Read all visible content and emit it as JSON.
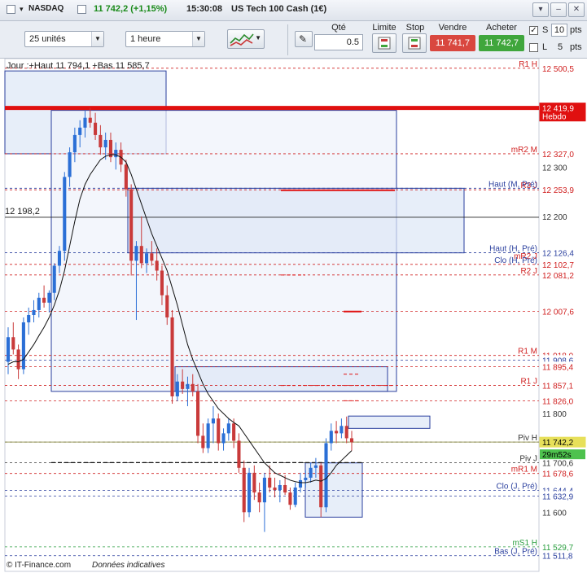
{
  "header": {
    "symbol": "NASDAQ",
    "price": "11 742,2 (+1,15%)",
    "time": "15:30:08",
    "instrument": "US Tech 100 Cash (1€)"
  },
  "window_buttons": [
    "▾",
    "–",
    "✕"
  ],
  "toolbar": {
    "units_select": "25 unités",
    "period_select": "1 heure",
    "qty_label": "Qté",
    "qty_value": "0.5",
    "limit_label": "Limite",
    "stop_label": "Stop",
    "sell_label": "Vendre",
    "sell_price": "11 741,7",
    "buy_label": "Acheter",
    "buy_price": "11 742,7",
    "s_value": "10",
    "s_label": "S",
    "l_value": "5",
    "l_label": "L",
    "pts_label": "pts",
    "colors": {
      "sell": "#d9473f",
      "buy": "#3fa63c"
    }
  },
  "chart": {
    "info_text": "Jour :+Haut 11 794,1 +Bas 11 585,7",
    "crosshair_label": "12 198,2",
    "footer_brand": "© IT-Finance.com",
    "footer_note": "Données indicatives",
    "countdown": "29m52s",
    "price_axis": [
      "12 400",
      "12 300",
      "12 200",
      "11 800",
      "11 600"
    ],
    "right_tags": [
      {
        "text": "12 500,5",
        "value": 12500.5,
        "color": "#d02020"
      },
      {
        "text": "12 419,9",
        "value": 12419.9,
        "color": "#d02020",
        "sub": "Hebdo",
        "fill": true
      },
      {
        "text": "12 327,0",
        "value": 12327.0,
        "color": "#d02020"
      },
      {
        "text": "12 257,0",
        "value": 12257.0,
        "color": "#2a3f9e"
      },
      {
        "text": "12 253,9",
        "value": 12253.9,
        "color": "#d02020"
      },
      {
        "text": "12 126,4",
        "value": 12126.4,
        "color": "#2a3f9e"
      },
      {
        "text": "12 102,7",
        "value": 12102.7,
        "color": "#d02020"
      },
      {
        "text": "12 081,2",
        "value": 12081.2,
        "color": "#d02020"
      },
      {
        "text": "12 007,6",
        "value": 12007.6,
        "color": "#d02020"
      },
      {
        "text": "11 918,0",
        "value": 11918.0,
        "color": "#d02020"
      },
      {
        "text": "11 908,6",
        "value": 11908.6,
        "color": "#2a3f9e"
      },
      {
        "text": "11 895,4",
        "value": 11895.4,
        "color": "#d02020"
      },
      {
        "text": "11 857,1",
        "value": 11857.1,
        "color": "#d02020"
      },
      {
        "text": "11 826,0",
        "value": 11826.0,
        "color": "#d02020"
      },
      {
        "text": "11 742,2",
        "value": 11742.2,
        "color": "#333",
        "fill": "#e7e05a"
      },
      {
        "text": "11 700,6",
        "value": 11700.6,
        "color": "#333"
      },
      {
        "text": "11 678,6",
        "value": 11678.6,
        "color": "#d02020"
      },
      {
        "text": "11 644,4",
        "value": 11644.4,
        "color": "#2a3f9e"
      },
      {
        "text": "11 632,9",
        "value": 11632.9,
        "color": "#2a3f9e"
      },
      {
        "text": "11 529,7",
        "value": 11529.7,
        "color": "#2a9e3f"
      },
      {
        "text": "11 511,8",
        "value": 11511.8,
        "color": "#2a3f9e"
      }
    ],
    "level_labels": [
      {
        "text": "R1 H",
        "value": 12500.5,
        "color": "#d02020"
      },
      {
        "text": "mR2 M",
        "value": 12327.0,
        "color": "#d02020"
      },
      {
        "text": "R3 J",
        "value": 12253.9,
        "color": "#d02020"
      },
      {
        "text": "Haut (M, Pré)",
        "value": 12257.0,
        "color": "#2a3f9e"
      },
      {
        "text": "Haut (H, Pré)",
        "value": 12126.4,
        "color": "#2a3f9e"
      },
      {
        "text": "mR2 J",
        "value": 12111.0,
        "color": "#d02020"
      },
      {
        "text": "Clo (H, Pré)",
        "value": 12102.7,
        "color": "#2a3f9e"
      },
      {
        "text": "R2 J",
        "value": 12081.2,
        "color": "#d02020"
      },
      {
        "text": "R1 M",
        "value": 11918.0,
        "color": "#d02020"
      },
      {
        "text": "R1 J",
        "value": 11857.1,
        "color": "#d02020"
      },
      {
        "text": "Piv H",
        "value": 11742.2,
        "color": "#333"
      },
      {
        "text": "Piv J",
        "value": 11700.6,
        "color": "#333"
      },
      {
        "text": "mR1 M",
        "value": 11678.6,
        "color": "#d02020"
      },
      {
        "text": "Clo (J, Pré)",
        "value": 11644.4,
        "color": "#2a3f9e"
      },
      {
        "text": "mS1 H",
        "value": 11529.7,
        "color": "#2a9e3f"
      },
      {
        "text": "Bas (J, Pré)",
        "value": 11511.8,
        "color": "#2a3f9e"
      }
    ]
  },
  "chart_data": {
    "type": "candlestick",
    "title": "US Tech 100 Cash (1€)",
    "timeframe": "1 heure",
    "ylim": [
      11480,
      12520
    ],
    "y_ticks": [
      12400,
      12300,
      12200,
      11800,
      11600
    ],
    "candles": [
      [
        11905,
        11975,
        11880,
        11955
      ],
      [
        11955,
        11985,
        11920,
        11930
      ],
      [
        11930,
        11940,
        11870,
        11890
      ],
      [
        11890,
        11995,
        11880,
        11985
      ],
      [
        11985,
        12015,
        11960,
        12000
      ],
      [
        12000,
        12030,
        11985,
        12010
      ],
      [
        12010,
        12045,
        11995,
        12035
      ],
      [
        12035,
        12060,
        12015,
        12025
      ],
      [
        12025,
        12050,
        12005,
        12045
      ],
      [
        12045,
        12105,
        12030,
        12100
      ],
      [
        12100,
        12140,
        12085,
        12130
      ],
      [
        12130,
        12290,
        12110,
        12280
      ],
      [
        12280,
        12340,
        12260,
        12330
      ],
      [
        12330,
        12380,
        12310,
        12365
      ],
      [
        12365,
        12395,
        12340,
        12380
      ],
      [
        12380,
        12415,
        12360,
        12400
      ],
      [
        12400,
        12420,
        12380,
        12390
      ],
      [
        12390,
        12410,
        12355,
        12365
      ],
      [
        12365,
        12385,
        12325,
        12340
      ],
      [
        12340,
        12370,
        12315,
        12355
      ],
      [
        12355,
        12370,
        12310,
        12320
      ],
      [
        12320,
        12350,
        12295,
        12335
      ],
      [
        12335,
        12350,
        12290,
        12305
      ],
      [
        12305,
        12315,
        12240,
        12255
      ],
      [
        12255,
        12265,
        12080,
        12110
      ],
      [
        12110,
        12150,
        11990,
        12140
      ],
      [
        12140,
        12200,
        12095,
        12105
      ],
      [
        12105,
        12135,
        12085,
        12125
      ],
      [
        12125,
        12150,
        12100,
        12110
      ],
      [
        12110,
        12135,
        12070,
        12090
      ],
      [
        12090,
        12100,
        12020,
        12040
      ],
      [
        12040,
        12060,
        11980,
        11995
      ],
      [
        11995,
        12010,
        11820,
        11835
      ],
      [
        11835,
        11880,
        11825,
        11865
      ],
      [
        11865,
        11890,
        11840,
        11850
      ],
      [
        11850,
        11875,
        11815,
        11860
      ],
      [
        11860,
        11880,
        11835,
        11845
      ],
      [
        11845,
        11860,
        11740,
        11755
      ],
      [
        11755,
        11780,
        11720,
        11730
      ],
      [
        11730,
        11790,
        11720,
        11780
      ],
      [
        11780,
        11815,
        11740,
        11790
      ],
      [
        11790,
        11800,
        11725,
        11740
      ],
      [
        11740,
        11770,
        11725,
        11760
      ],
      [
        11760,
        11790,
        11745,
        11780
      ],
      [
        11780,
        11790,
        11730,
        11745
      ],
      [
        11745,
        11760,
        11680,
        11690
      ],
      [
        11690,
        11705,
        11580,
        11600
      ],
      [
        11600,
        11690,
        11590,
        11680
      ],
      [
        11680,
        11695,
        11625,
        11640
      ],
      [
        11640,
        11660,
        11600,
        11620
      ],
      [
        11620,
        11680,
        11560,
        11670
      ],
      [
        11670,
        11695,
        11640,
        11650
      ],
      [
        11650,
        11670,
        11630,
        11645
      ],
      [
        11645,
        11665,
        11620,
        11655
      ],
      [
        11655,
        11675,
        11635,
        11640
      ],
      [
        11640,
        11650,
        11605,
        11615
      ],
      [
        11615,
        11660,
        11610,
        11650
      ],
      [
        11650,
        11680,
        11640,
        11665
      ],
      [
        11665,
        11685,
        11650,
        11670
      ],
      [
        11670,
        11700,
        11660,
        11690
      ],
      [
        11690,
        11710,
        11670,
        11695
      ],
      [
        11695,
        11700,
        11590,
        11610
      ],
      [
        11610,
        11750,
        11600,
        11740
      ],
      [
        11740,
        11780,
        11725,
        11765
      ],
      [
        11765,
        11785,
        11740,
        11760
      ],
      [
        11760,
        11790,
        11750,
        11775
      ],
      [
        11775,
        11794,
        11740,
        11750
      ],
      [
        11750,
        11765,
        11725,
        11742
      ]
    ],
    "ma_close": [
      11900,
      11905,
      11905,
      11910,
      11925,
      11940,
      11958,
      11975,
      11995,
      12020,
      12050,
      12090,
      12140,
      12190,
      12235,
      12265,
      12285,
      12300,
      12315,
      12322,
      12325,
      12325,
      12320,
      12310,
      12285,
      12255,
      12225,
      12195,
      12165,
      12140,
      12115,
      12090,
      12055,
      12020,
      11980,
      11940,
      11910,
      11885,
      11860,
      11840,
      11825,
      11810,
      11800,
      11790,
      11782,
      11775,
      11760,
      11745,
      11730,
      11715,
      11700,
      11690,
      11680,
      11675,
      11670,
      11665,
      11662,
      11660,
      11660,
      11662,
      11665,
      11663,
      11668,
      11680,
      11695,
      11705,
      11715,
      11725
    ],
    "colors": {
      "up": "#2b6fd6",
      "down": "#c93a3a",
      "ma": "#111111"
    }
  }
}
